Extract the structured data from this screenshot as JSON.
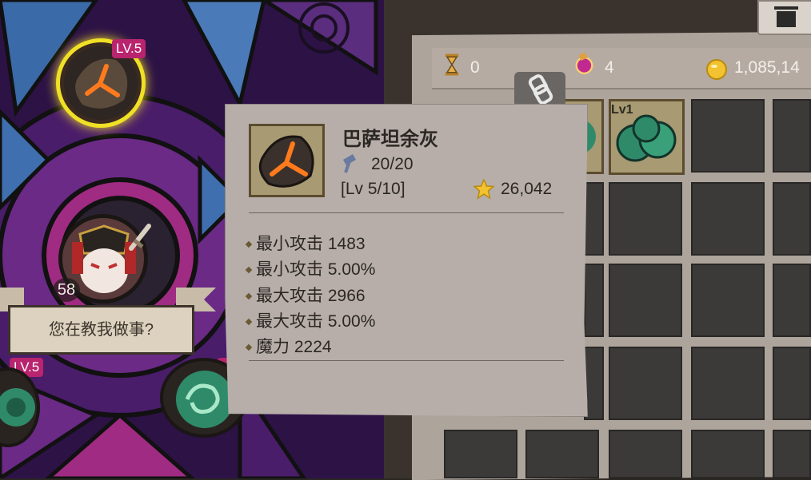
{
  "resources": [
    {
      "icon": "hourglass-icon",
      "value": "0"
    },
    {
      "icon": "potion-icon",
      "value": "4"
    },
    {
      "icon": "gold-coin-icon",
      "value": "1,085,14"
    }
  ],
  "equipped": {
    "top_level": "LV.5",
    "left_level": "LV.5",
    "right_level_partial": "L"
  },
  "character": {
    "level": "58",
    "speech": "您在教我做事?"
  },
  "inventory": {
    "slot_level": "Lv1",
    "slot_level_partial": "Lv1"
  },
  "tooltip": {
    "name": "巴萨坦余灰",
    "durability": "20/20",
    "level": "[Lv 5/10]",
    "score": "26,042",
    "stats": [
      "最小攻击 1483",
      "最小攻击 5.00%",
      "最大攻击 2966",
      "最大攻击 5.00%",
      "魔力 2224"
    ]
  },
  "colors": {
    "tooltip_bg": "#b7aeaa",
    "gold": "#f2c230",
    "level_badge": "#b9246e",
    "selected_ring": "#f0e026"
  }
}
